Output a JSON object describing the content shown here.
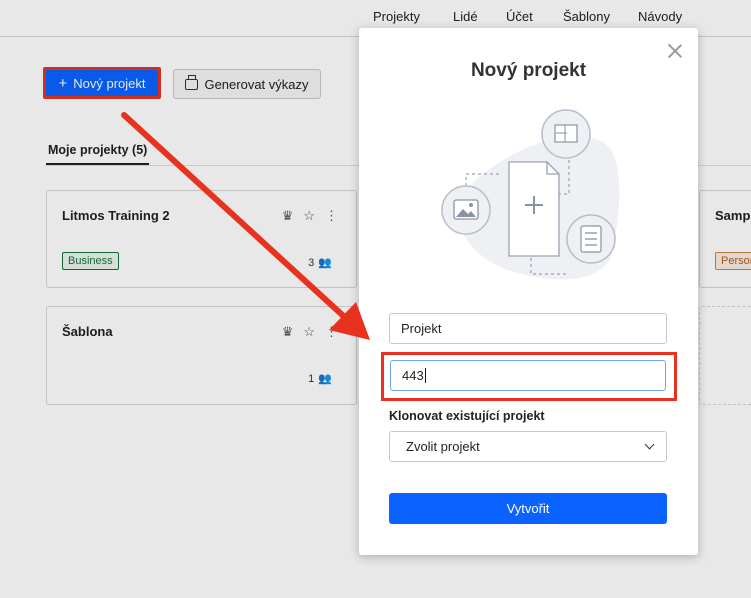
{
  "topnav": [
    "Projekty",
    "Lidé",
    "Účet",
    "Šablony",
    "Návody"
  ],
  "toolbar": {
    "new_project_label": "Nový projekt",
    "report_label": "Generovat výkazy"
  },
  "tabs": {
    "my_projects": "Moje projekty (5)"
  },
  "cards": [
    {
      "title": "Litmos Training 2",
      "badge": "Business",
      "members": "3"
    },
    {
      "title": "Šablona",
      "members": "1"
    },
    {
      "title": "Sampl",
      "badge": "Person"
    }
  ],
  "modal": {
    "title": "Nový projekt",
    "name_value": "Projekt",
    "number_value": "443",
    "clone_label": "Klonovat existující projekt",
    "clone_select_value": "Zvolit projekt",
    "create_label": "Vytvořit"
  },
  "colors": {
    "accent": "#0a63ff",
    "highlight": "#e8321f"
  }
}
